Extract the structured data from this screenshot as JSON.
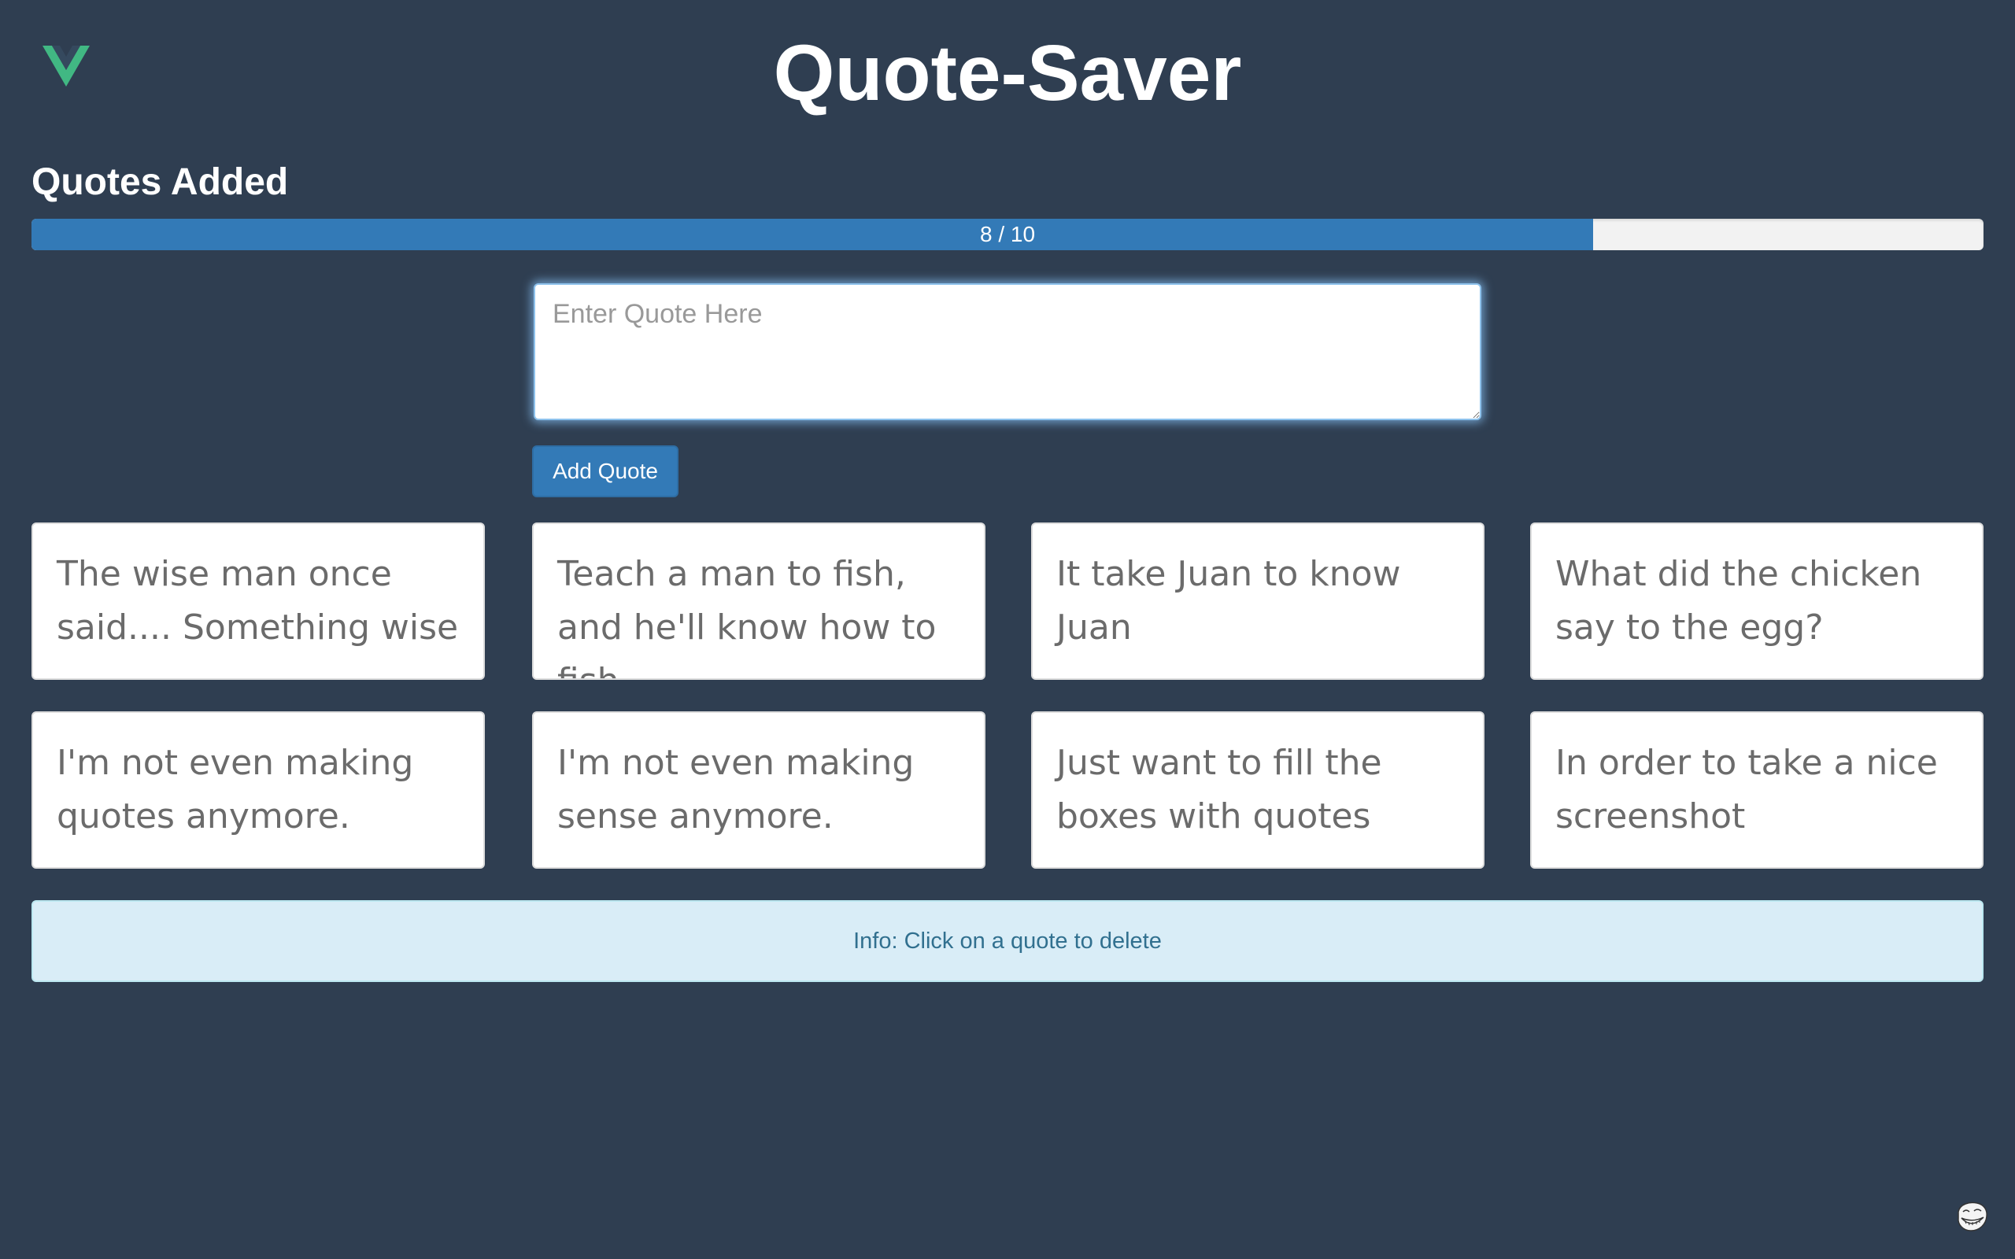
{
  "header": {
    "logo_icon": "vue-logo-icon",
    "title": "Quote-Saver"
  },
  "progress": {
    "heading": "Quotes Added",
    "label": "8 / 10",
    "value": 8,
    "max": 10,
    "fraction": 0.8,
    "bar_color": "#337ab7"
  },
  "form": {
    "placeholder": "Enter Quote Here",
    "value": "",
    "button_label": "Add Quote"
  },
  "quotes": [
    "The wise man once said.... Something wise",
    "Teach a man to fish, and he'll know how to fish.",
    "It take Juan to know Juan",
    "What did the chicken say to the egg?",
    "I'm not even making quotes anymore.",
    "I'm not even making sense anymore.",
    "Just want to fill the boxes with quotes",
    "In order to take a nice screenshot"
  ],
  "info": {
    "text": "Info: Click on a quote to delete"
  },
  "colors": {
    "background": "#2f3e51",
    "accent": "#337ab7",
    "vue_green": "#41b883",
    "info_bg": "#d9edf7",
    "info_text": "#31708f"
  },
  "footer": {
    "icon": "troll-face-icon"
  }
}
